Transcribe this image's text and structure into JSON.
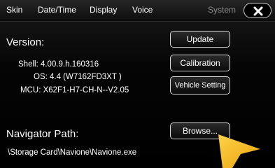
{
  "tabs": {
    "skin": "Skin",
    "datetime": "Date/Time",
    "display": "Display",
    "voice": "Voice",
    "system": "System"
  },
  "version": {
    "title": "Version:",
    "shell": "Shell: 4.00.9.h.160316",
    "os": "OS: 4.4 (W7162FD3XT )",
    "mcu": "MCU: X62F1-H7-CH-N--V2.05"
  },
  "navigator": {
    "title": "Navigator Path:",
    "path": "\\Storage Card\\Navione\\Navione.exe"
  },
  "buttons": {
    "update": "Update",
    "calibration": "Calibration",
    "vehicle_setting": "Vehicle Setting",
    "browse": "Browse..."
  },
  "icons": {
    "close": "close-icon",
    "pointer": "pointer-arrow-icon"
  },
  "colors": {
    "background": "#000000",
    "text": "#ffffff",
    "inactive_tab": "#8a8a8a",
    "pointer": "#f6b81a"
  }
}
